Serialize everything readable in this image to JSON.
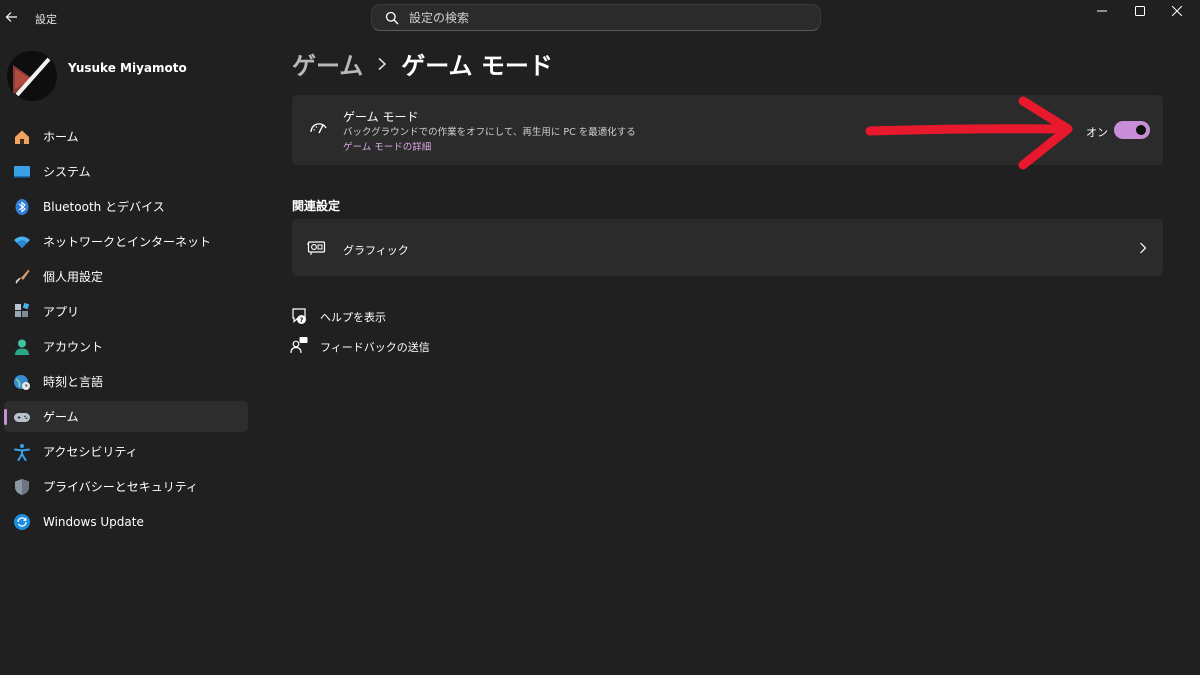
{
  "window": {
    "title": "設定",
    "controls": [
      "minimize-icon",
      "maximize-icon",
      "close-icon"
    ]
  },
  "search": {
    "placeholder": "設定の検索"
  },
  "profile": {
    "name": "Yusuke Miyamoto"
  },
  "sidebar": {
    "items": [
      {
        "label": "ホーム",
        "icon": "home-icon"
      },
      {
        "label": "システム",
        "icon": "system-icon"
      },
      {
        "label": "Bluetooth とデバイス",
        "icon": "bluetooth-icon"
      },
      {
        "label": "ネットワークとインターネット",
        "icon": "wifi-icon"
      },
      {
        "label": "個人用設定",
        "icon": "brush-icon"
      },
      {
        "label": "アプリ",
        "icon": "apps-icon"
      },
      {
        "label": "アカウント",
        "icon": "account-icon"
      },
      {
        "label": "時刻と言語",
        "icon": "globe-clock-icon"
      },
      {
        "label": "ゲーム",
        "icon": "gamepad-icon",
        "active": true
      },
      {
        "label": "アクセシビリティ",
        "icon": "accessibility-icon"
      },
      {
        "label": "プライバシーとセキュリティ",
        "icon": "shield-icon"
      },
      {
        "label": "Windows Update",
        "icon": "update-icon"
      }
    ]
  },
  "breadcrumb": {
    "parent": "ゲーム",
    "current": "ゲーム モード"
  },
  "game_mode": {
    "title": "ゲーム モード",
    "description": "バックグラウンドでの作業をオフにして、再生用に PC を最適化する",
    "link": "ゲーム モードの詳細",
    "toggle_label": "オン",
    "enabled": true
  },
  "related": {
    "title": "関連設定",
    "graphics_label": "グラフィック"
  },
  "footer": {
    "help_label": "ヘルプを表示",
    "feedback_label": "フィードバックの送信"
  },
  "colors": {
    "accent": "#c88fd8",
    "background": "#202020",
    "card": "#2b2b2b",
    "annotation_arrow": "#e8192c"
  }
}
